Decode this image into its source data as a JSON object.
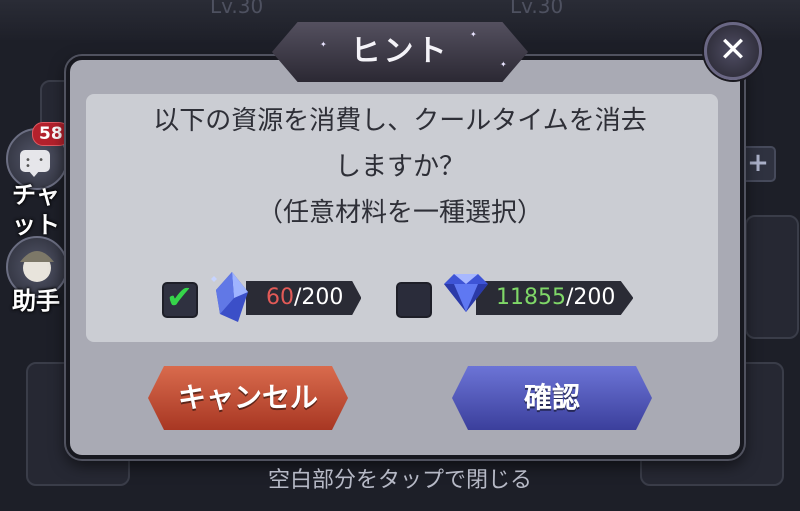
{
  "background": {
    "level_left": "Lv.30",
    "level_right": "Lv.30"
  },
  "sidebar": {
    "chat_badge": "58",
    "chat_label_line1": "チャ",
    "chat_label_line2": "ット",
    "assistant_label": "助手"
  },
  "dialog": {
    "title": "ヒント",
    "message_line1": "以下の資源を消費し、クールタイムを消去",
    "message_line2": "しますか？",
    "message_line3": "（任意材料を一種選択）",
    "option1": {
      "checked": true,
      "have": "60",
      "need": "/200",
      "icon": "blue-crystal-icon"
    },
    "option2": {
      "checked": false,
      "have": "11855",
      "need": "/200",
      "icon": "diamond-icon"
    },
    "cancel_label": "キャンセル",
    "confirm_label": "確認"
  },
  "footer_text": "空白部分をタップで閉じる"
}
